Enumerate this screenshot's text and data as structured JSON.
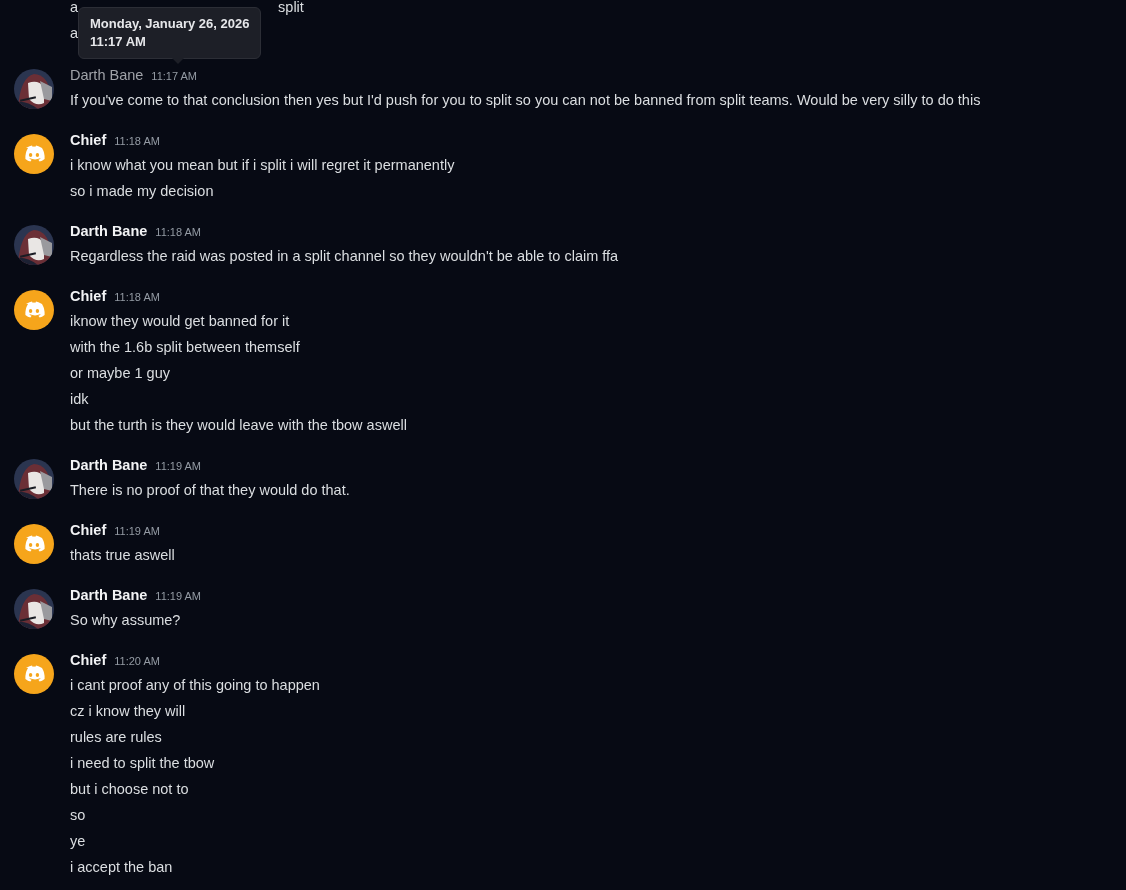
{
  "previous_message": {
    "line_1_start": "a",
    "line_1_end": "split",
    "line_2": "a"
  },
  "tooltip": {
    "date": "Monday, January 26, 2026",
    "time": "11:17 AM"
  },
  "messages": [
    {
      "author": "Darth Bane",
      "kind": "picture",
      "dimmed": true,
      "time": "11:17 AM",
      "lines": [
        "If you've come to that conclusion then yes but I'd push for you to split so you can not be banned from split teams. Would be very silly to do this"
      ]
    },
    {
      "author": "Chief",
      "kind": "logo",
      "dimmed": false,
      "time": "11:18 AM",
      "lines": [
        "i know what you mean but if i split i will regret it permanently",
        "so i made my decision"
      ]
    },
    {
      "author": "Darth Bane",
      "kind": "picture",
      "dimmed": false,
      "time": "11:18 AM",
      "lines": [
        "Regardless the raid was posted in a split channel so they wouldn't be able to claim ffa"
      ]
    },
    {
      "author": "Chief",
      "kind": "logo",
      "dimmed": false,
      "time": "11:18 AM",
      "lines": [
        "iknow they would get banned for it",
        "with the 1.6b split between themself",
        "or maybe 1 guy",
        "idk",
        "but the turth is they would leave with the tbow aswell"
      ]
    },
    {
      "author": "Darth Bane",
      "kind": "picture",
      "dimmed": false,
      "time": "11:19 AM",
      "lines": [
        "There is no proof of that they would do that."
      ]
    },
    {
      "author": "Chief",
      "kind": "logo",
      "dimmed": false,
      "time": "11:19 AM",
      "lines": [
        "thats true aswell"
      ]
    },
    {
      "author": "Darth Bane",
      "kind": "picture",
      "dimmed": false,
      "time": "11:19 AM",
      "lines": [
        "So why assume?"
      ]
    },
    {
      "author": "Chief",
      "kind": "logo",
      "dimmed": false,
      "time": "11:20 AM",
      "lines": [
        "i cant proof any of this going to happen",
        "cz i know they will",
        "rules are rules",
        "i need to split the tbow",
        "but i choose not to",
        "so",
        "ye",
        "i accept the ban"
      ]
    }
  ]
}
